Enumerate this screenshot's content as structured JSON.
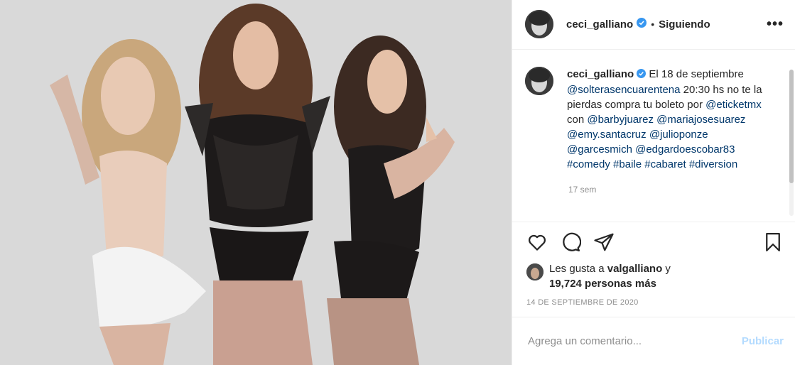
{
  "header": {
    "username": "ceci_galliano",
    "separator": "•",
    "follow_label": "Siguiendo",
    "more_label": "•••"
  },
  "caption": {
    "username": "ceci_galliano",
    "parts": [
      {
        "text": " El 18 de septiembre ",
        "link": false
      },
      {
        "text": "@solterasencuarentena",
        "link": true
      },
      {
        "text": " 20:30 hs no te la pierdas compra tu boleto por ",
        "link": false
      },
      {
        "text": "@eticketmx",
        "link": true
      },
      {
        "text": " con ",
        "link": false
      },
      {
        "text": "@barbyjuarez",
        "link": true
      },
      {
        "text": " ",
        "link": false
      },
      {
        "text": "@mariajosesuarez",
        "link": true
      },
      {
        "text": " ",
        "link": false
      },
      {
        "text": "@emy.santacruz",
        "link": true
      },
      {
        "text": " ",
        "link": false
      },
      {
        "text": "@julioponze",
        "link": true
      },
      {
        "text": " ",
        "link": false
      },
      {
        "text": "@garcesmich",
        "link": true
      },
      {
        "text": " ",
        "link": false
      },
      {
        "text": "@edgardoescobar83",
        "link": true
      },
      {
        "text": " ",
        "link": false
      },
      {
        "text": "#comedy",
        "link": true
      },
      {
        "text": " ",
        "link": false
      },
      {
        "text": "#baile",
        "link": true
      },
      {
        "text": " ",
        "link": false
      },
      {
        "text": "#cabaret",
        "link": true
      },
      {
        "text": " ",
        "link": false
      },
      {
        "text": "#diversion",
        "link": true
      }
    ],
    "time": "17 sem"
  },
  "likes": {
    "prefix": "Les gusta a ",
    "user": "valgalliano",
    "middle": " y",
    "count": "19,724 personas más"
  },
  "date": "14 DE SEPTIEMBRE DE 2020",
  "composer": {
    "placeholder": "Agrega un comentario...",
    "publish_label": "Publicar"
  },
  "icons": {
    "like": "heart-icon",
    "comment": "comment-icon",
    "share": "share-icon",
    "save": "bookmark-icon",
    "verified": "verified-badge-icon"
  },
  "colors": {
    "link": "#00376b",
    "verified": "#3897f0",
    "publish_disabled": "#b3dbff",
    "muted": "#8e8e8e"
  }
}
